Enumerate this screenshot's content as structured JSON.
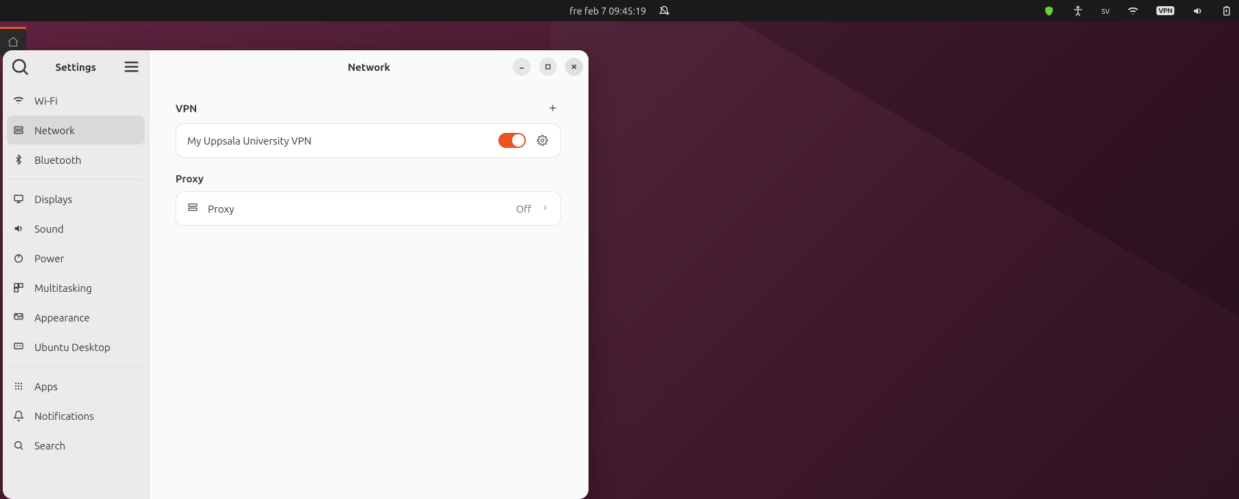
{
  "topbar": {
    "datetime": "fre feb 7  09:45:19",
    "language": "sv",
    "vpn_badge": "VPN"
  },
  "window": {
    "title": "Network",
    "sidebar_title": "Settings"
  },
  "sidebar": {
    "items": [
      {
        "key": "wifi",
        "label": "Wi-Fi"
      },
      {
        "key": "network",
        "label": "Network"
      },
      {
        "key": "bluetooth",
        "label": "Bluetooth"
      },
      {
        "key": "sep"
      },
      {
        "key": "displays",
        "label": "Displays"
      },
      {
        "key": "sound",
        "label": "Sound"
      },
      {
        "key": "power",
        "label": "Power"
      },
      {
        "key": "multitasking",
        "label": "Multitasking"
      },
      {
        "key": "appearance",
        "label": "Appearance"
      },
      {
        "key": "ubuntudesktop",
        "label": "Ubuntu Desktop"
      },
      {
        "key": "sep"
      },
      {
        "key": "apps",
        "label": "Apps"
      },
      {
        "key": "notifications",
        "label": "Notifications"
      },
      {
        "key": "search",
        "label": "Search"
      }
    ],
    "active_key": "network"
  },
  "vpn": {
    "heading": "VPN",
    "connections": [
      {
        "name": "My Uppsala University VPN",
        "enabled": true
      }
    ]
  },
  "proxy": {
    "heading": "Proxy",
    "label": "Proxy",
    "status": "Off"
  },
  "colors": {
    "accent": "#e95420",
    "window_bg": "#fafafa",
    "sidebar_bg": "#ebebeb",
    "card_bg": "#ffffff"
  }
}
